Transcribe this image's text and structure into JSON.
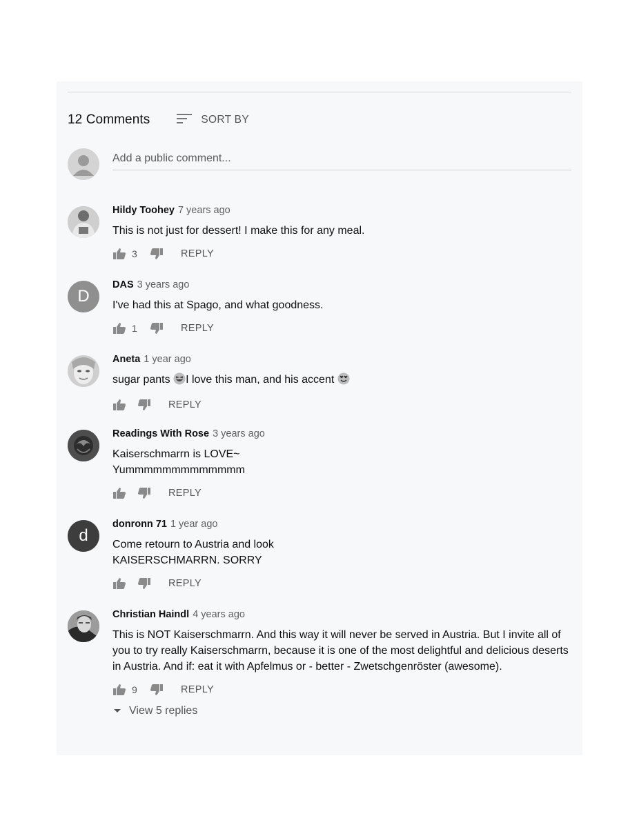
{
  "header": {
    "comment_count": "12 Comments",
    "sort_label": "SORT BY",
    "sort_icon": "sort-icon"
  },
  "add_comment": {
    "placeholder": "Add a public comment..."
  },
  "comments": [
    {
      "author": "Hildy Toohey",
      "time": "7 years ago",
      "text": "This is not just for dessert!  I make this for any meal.",
      "likes": "3",
      "reply_label": "REPLY"
    },
    {
      "author": "DAS",
      "time": "3 years ago",
      "text": "I've had this at Spago, and what goodness.",
      "likes": "1",
      "reply_label": "REPLY",
      "avatar_letter": "D"
    },
    {
      "author": "Aneta",
      "time": "1 year ago",
      "text_before": "sugar pants ",
      "text_middle": "I love this man, and his accent ",
      "likes": "",
      "reply_label": "REPLY"
    },
    {
      "author": "Readings With Rose",
      "time": "3 years ago",
      "text_line1": "Kaiserschmarrn is LOVE~",
      "text_line2": "Yummmmmmmmmmmmm",
      "likes": "",
      "reply_label": "REPLY"
    },
    {
      "author": "donronn 71",
      "time": "1 year ago",
      "text_line1": "Come retourn to Austria and look",
      "text_line2": "KAISERSCHMARRN. SORRY",
      "likes": "",
      "reply_label": "REPLY",
      "avatar_letter": "d"
    },
    {
      "author": "Christian Haindl",
      "time": "4 years ago",
      "text": "This is NOT Kaiserschmarrn. And this way it will never be served in Austria. But I invite all of you to try really Kaiserschmarrn, because it is one of the most delightful and delicious deserts in Austria. And if: eat it with Apfelmus or - better - Zwetschgenröster (awesome).",
      "likes": "9",
      "reply_label": "REPLY",
      "view_replies": "View 5 replies"
    }
  ],
  "colors": {
    "panel_bg": "#f7f8fa",
    "text": "#0f0f0f",
    "secondary": "#606060",
    "icon": "#8a8a8a"
  }
}
